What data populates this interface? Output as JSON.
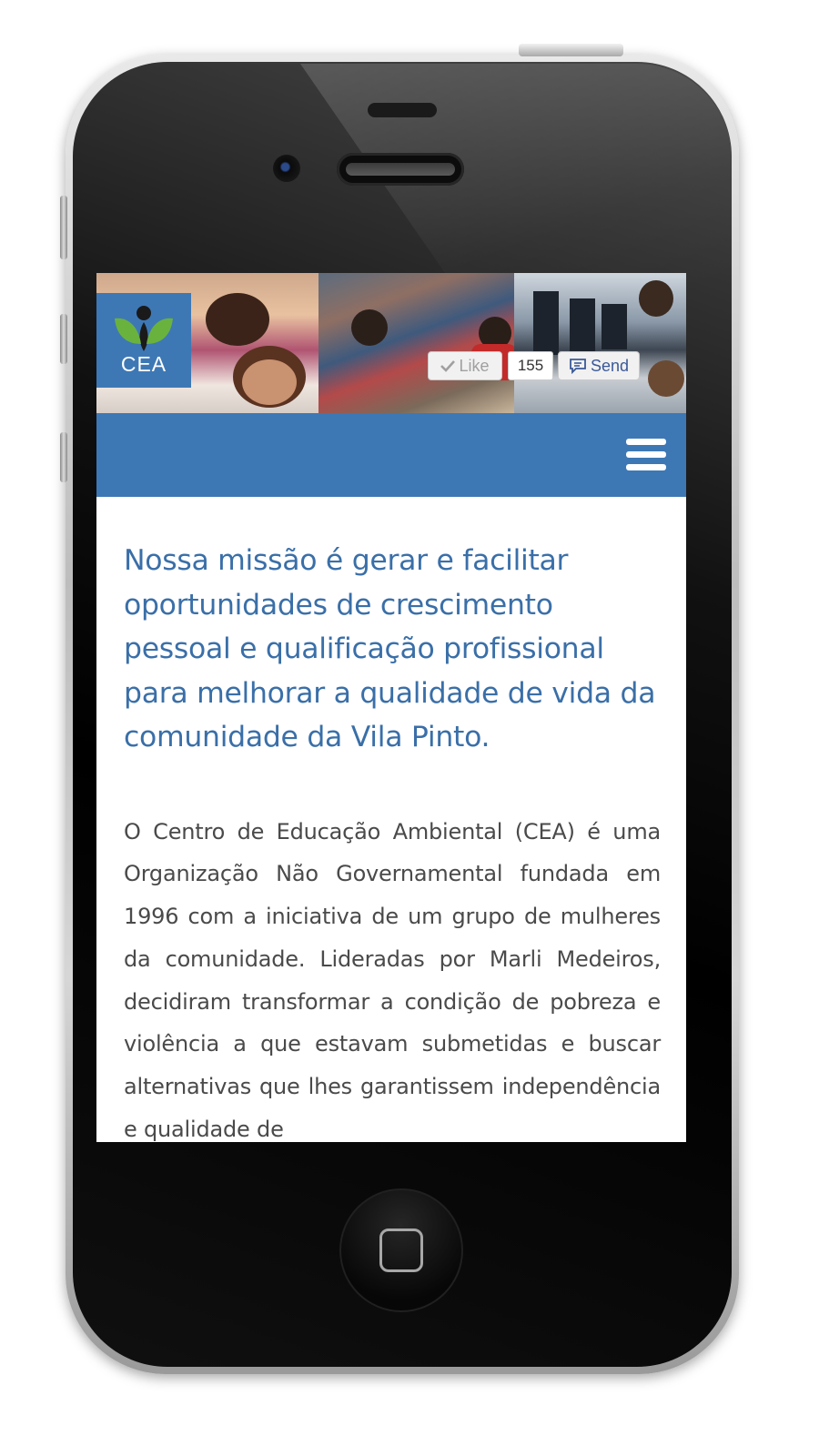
{
  "device": {
    "icons": {
      "home": "home-button-icon",
      "camera": "front-camera-icon",
      "speaker": "earpiece-speaker-icon"
    }
  },
  "site": {
    "logo_text": "CEA",
    "brand_color": "#3d78b5",
    "social": {
      "like_label": "Like",
      "like_count": "155",
      "send_label": "Send"
    },
    "nav": {
      "menu_icon": "hamburger-menu-icon"
    },
    "mission": "Nossa missão é gerar e facilitar oportunidades de crescimento pessoal e qualificação profissional para melhorar a qualidade de vida da comunidade da Vila Pinto.",
    "body": "O Centro de Educação Ambiental (CEA) é uma Organização Não Governamental fundada em 1996 com a iniciativa de um grupo de mulheres da comunidade. Lideradas por Marli Medeiros, decidiram transformar a condição de pobreza e violência a que estavam submetidas e buscar alternativas que lhes garantissem independência e qualidade de"
  }
}
